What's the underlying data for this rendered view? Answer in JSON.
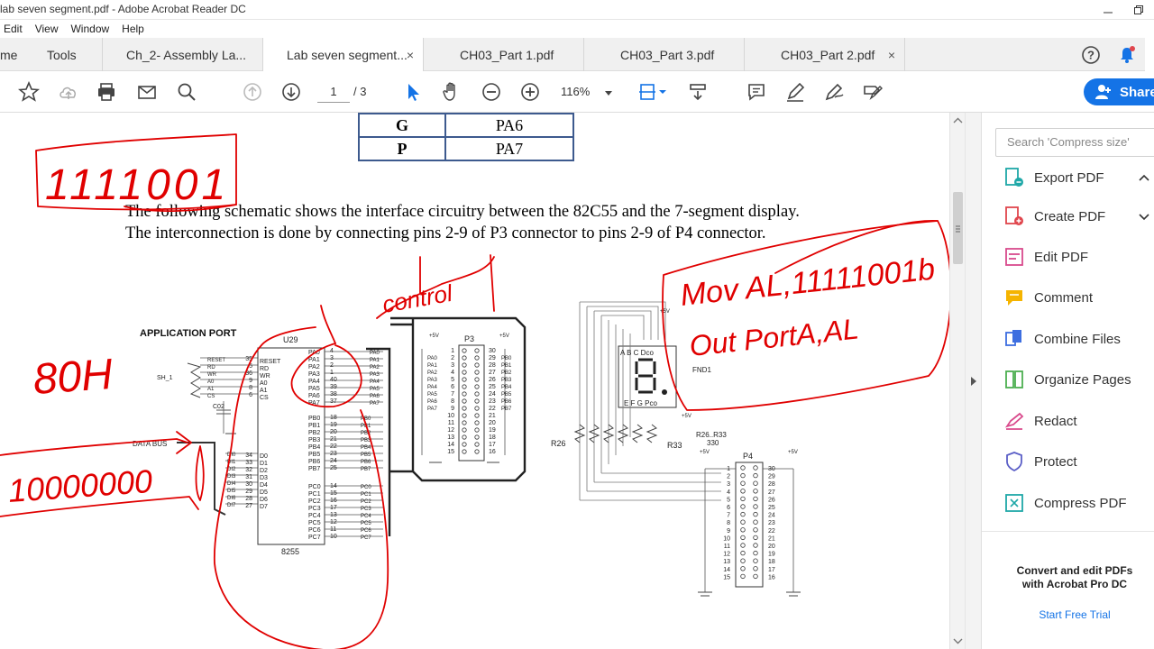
{
  "window": {
    "title": "lab seven segment.pdf - Adobe Acrobat Reader DC"
  },
  "menu": [
    "Edit",
    "View",
    "Window",
    "Help"
  ],
  "tabs": {
    "home": "me",
    "tools": "Tools",
    "docs": [
      {
        "label": "Ch_2- Assembly La..."
      },
      {
        "label": "Lab seven segment...",
        "close": "×"
      },
      {
        "label": "CH03_Part 1.pdf"
      },
      {
        "label": "CH03_Part 3.pdf"
      },
      {
        "label": "CH03_Part 2.pdf",
        "close": "×"
      }
    ]
  },
  "toolbar": {
    "page_current": "1",
    "page_total": "/ 3",
    "zoom": "116%",
    "share": "Share"
  },
  "document": {
    "table": [
      {
        "key": "G",
        "value": "PA6"
      },
      {
        "key": "P",
        "value": "PA7"
      }
    ],
    "paragraph": "The following schematic shows the interface circuitry between the 82C55 and the 7-segment display. The interconnection is done by connecting pins 2-9 of P3 connector to pins 2-9 of P4 connector.",
    "schematic": {
      "application_port": "APPLICATION PORT",
      "u29": "U29",
      "chip_name": "8255",
      "p3": "P3",
      "p4": "P4",
      "fnd": "FND1",
      "data_bus": "DATA BUS",
      "sh1": "SH_1",
      "c02": "C02",
      "r26": "R26",
      "r33": "R33",
      "r_range": "R26..R33",
      "r_value": "330",
      "plus5v": "+5V",
      "seg_top": "A B C Dco",
      "seg_bot": "E F G Pco",
      "ctrl_labels": [
        "RESET",
        "RD",
        "WR",
        "A0",
        "A1",
        "CS"
      ],
      "pa_labels": [
        "PA0",
        "PA1",
        "PA2",
        "PA3",
        "PA4",
        "PA5",
        "PA6",
        "PA7"
      ],
      "pa_pins": [
        "4",
        "3",
        "2",
        "1",
        "40",
        "39",
        "38",
        "37"
      ],
      "pb_labels": [
        "PB0",
        "PB1",
        "PB2",
        "PB3",
        "PB4",
        "PB5",
        "PB6",
        "PB7"
      ],
      "pb_pins": [
        "18",
        "19",
        "20",
        "21",
        "22",
        "23",
        "24",
        "25"
      ],
      "pc_labels": [
        "PC0",
        "PC1",
        "PC2",
        "PC3",
        "PC4",
        "PC5",
        "PC6",
        "PC7"
      ],
      "pc_pins": [
        "14",
        "15",
        "16",
        "17",
        "13",
        "12",
        "11",
        "10"
      ],
      "d_labels": [
        "D0",
        "D1",
        "D2",
        "D3",
        "D4",
        "D5",
        "D6",
        "D7"
      ],
      "d_pins": [
        "34",
        "33",
        "32",
        "31",
        "30",
        "29",
        "28",
        "27"
      ],
      "ctrl_pins": [
        "35",
        "5",
        "36",
        "9",
        "8",
        "6"
      ],
      "p3_left": [
        "1",
        "2",
        "3",
        "4",
        "5",
        "6",
        "7",
        "8",
        "9",
        "10",
        "11",
        "12",
        "13",
        "14",
        "15"
      ],
      "p3_right": [
        "30",
        "29",
        "28",
        "27",
        "26",
        "25",
        "24",
        "23",
        "22",
        "21",
        "20",
        "19",
        "18",
        "17",
        "16"
      ],
      "p4_left": [
        "1",
        "2",
        "3",
        "4",
        "5",
        "6",
        "7",
        "8",
        "9",
        "10",
        "11",
        "12",
        "13",
        "14",
        "15"
      ],
      "p4_right": [
        "30",
        "29",
        "28",
        "27",
        "26",
        "25",
        "24",
        "23",
        "22",
        "21",
        "20",
        "19",
        "18",
        "17",
        "16"
      ]
    },
    "handwriting": {
      "binary_top": "1111001",
      "mov": "Mov AL,11111001b",
      "out": "Out PortA,AL",
      "port": "80H",
      "control": "control",
      "data": "10000000"
    }
  },
  "right_pane": {
    "search_placeholder": "Search 'Compress size'",
    "tools": [
      {
        "label": "Export PDF",
        "color": "#1fa8a8"
      },
      {
        "label": "Create PDF",
        "color": "#e0464d"
      },
      {
        "label": "Edit PDF",
        "color": "#d94a8c"
      },
      {
        "label": "Comment",
        "color": "#f5b400"
      },
      {
        "label": "Combine Files",
        "color": "#3d6ee0"
      },
      {
        "label": "Organize Pages",
        "color": "#4caf50"
      },
      {
        "label": "Redact",
        "color": "#d94a8c"
      },
      {
        "label": "Protect",
        "color": "#5b5fc7"
      },
      {
        "label": "Compress PDF",
        "color": "#1fa8a8"
      }
    ],
    "promo": "Convert and edit PDFs with Acrobat Pro DC",
    "trial": "Start Free Trial"
  },
  "colors": {
    "accent": "#1473e6",
    "ink": "#e00000"
  }
}
